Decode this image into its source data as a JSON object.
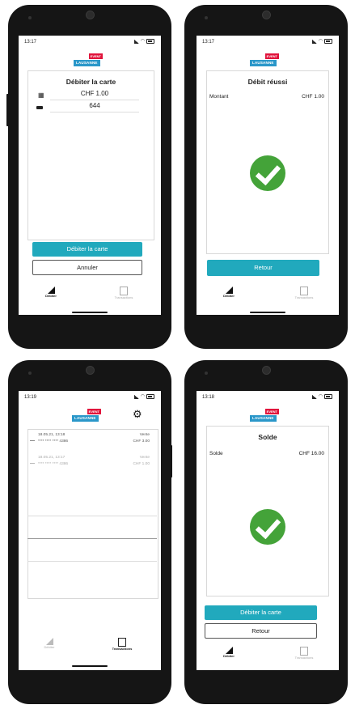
{
  "status_bar": {
    "screen1_time": "13:17",
    "screen2_time": "13:17",
    "screen3_time": "13:19",
    "screen4_time": "13:18"
  },
  "logo": {
    "badge_text": "EVENT",
    "name_text": "LAUSANNE"
  },
  "screen1": {
    "title": "Débiter la carte",
    "amount": "CHF 1.00",
    "pin": "644",
    "primary_button": "Débiter la carte",
    "secondary_button": "Annuler"
  },
  "screen2": {
    "title": "Débit réussi",
    "amount_label": "Montant",
    "amount_value": "CHF 1.00",
    "button": "Retour"
  },
  "screen3": {
    "transactions": [
      {
        "date": "18.05.21, 13:18",
        "type": "Vente",
        "card": "**** **** **** 4386",
        "amount": "CHF 3.00"
      },
      {
        "date": "18.05.21, 13:17",
        "type": "Vente",
        "card": "**** **** **** 4386",
        "amount": "CHF 1.00"
      }
    ]
  },
  "screen4": {
    "title": "Solde",
    "balance_label": "Solde",
    "balance_value": "CHF 16.00",
    "primary_button": "Débiter la carte",
    "secondary_button": "Retour"
  },
  "nav": {
    "reader_label": "Débiter",
    "transactions_label": "Transactions"
  },
  "colors": {
    "accent": "#21a9bd",
    "success": "#44a339",
    "brand_red": "#e1143c",
    "brand_blue": "#2a97c9"
  }
}
